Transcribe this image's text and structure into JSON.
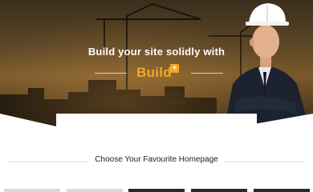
{
  "hero": {
    "headline": "Build your site solidly with",
    "logo_text": "Build",
    "logo_plus": "+"
  },
  "section": {
    "title": "Choose Your Favourite Homepage"
  },
  "colors": {
    "accent": "#f5a623",
    "hero_dark": "#3a2f1c"
  }
}
